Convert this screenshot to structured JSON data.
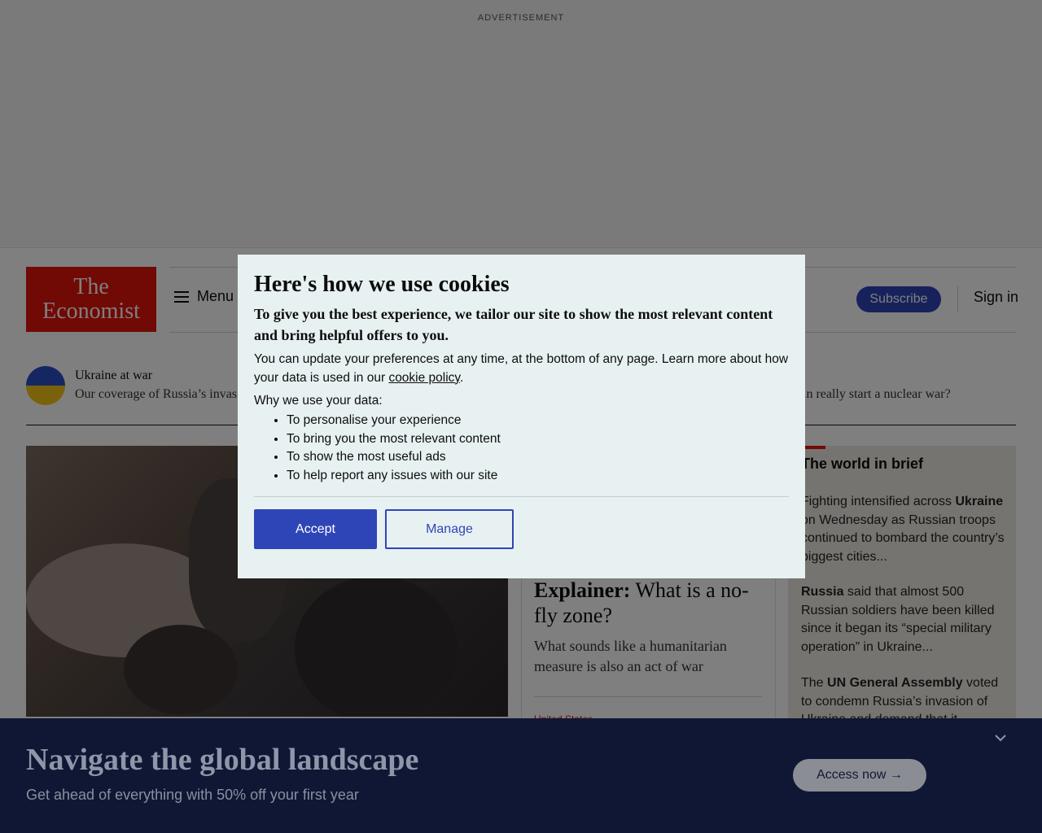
{
  "ad": {
    "label": "ADVERTISEMENT"
  },
  "header": {
    "logo_line1": "The",
    "logo_line2": "Economist",
    "menu_label": "Menu",
    "subscribe_label": "Subscribe",
    "signin_label": "Sign in"
  },
  "ukraine": {
    "title": "Ukraine at war",
    "subtitle": "Our coverage of Russia’s invas",
    "right_text": "in really start a nuclear war?"
  },
  "explainer": {
    "kicker": "Explainer:",
    "title": " What is a no-fly zone?",
    "subtitle": "What sounds like a humanitarian measure is also an act of war",
    "tag": "United States"
  },
  "brief": {
    "title": "The world in brief",
    "items": [
      {
        "pre": "Fighting intensified across ",
        "bold": "Ukraine",
        "post": " on Wednesday as Russian troops continued to bombard the country’s biggest cities..."
      },
      {
        "pre": "",
        "bold": "Russia",
        "post": " said that almost 500 Russian soldiers have been killed since it began its “special military operation” in Ukraine..."
      },
      {
        "pre": "The ",
        "bold": "UN General Assembly",
        "post": " voted to condemn Russia’s invasion of Ukraine and demand that it..."
      }
    ]
  },
  "cookie_modal": {
    "title": "Here's how we use cookies",
    "lead": "To give you the best experience, we tailor our site to show the most relevant content and bring helpful offers to you.",
    "text_pre": "You can update your preferences at any time, at the bottom of any page. Learn more about how your data is used in our ",
    "link_label": "cookie policy",
    "text_post": ".",
    "why_label": "Why we use your data:",
    "reasons": [
      "To personalise your experience",
      "To bring you the most relevant content",
      "To show the most useful ads",
      "To help report any issues with our site"
    ],
    "accept_label": "Accept",
    "manage_label": "Manage"
  },
  "banner": {
    "title": "Navigate the global landscape",
    "subtitle": "Get ahead of everything with 50% off your first year",
    "cta_label": "Access now →"
  }
}
